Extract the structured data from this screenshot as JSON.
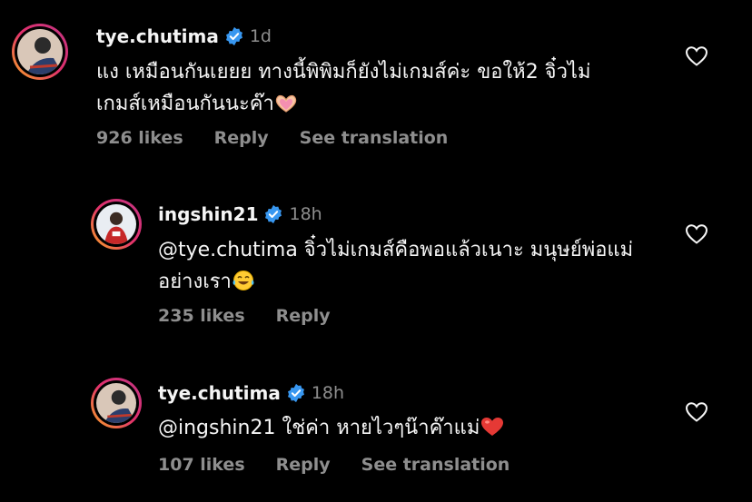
{
  "comments": [
    {
      "username": "tye.chutima",
      "time": "1d",
      "text_lines": [
        "แง เหมือนกันเยยย ทางนี้พิพิมก็ยังไม่เกมส์ค่ะ ขอให้2 จิ๋วไม่",
        "เกมส์เหมือนกันนะค๊า"
      ],
      "emoji_name": "heart-hands",
      "likes": "926 likes",
      "reply": "Reply",
      "translation": "See translation"
    },
    {
      "username": "ingshin21",
      "time": "18h",
      "text_lines": [
        "@tye.chutima จิ๋วไม่เกมส์คือพอแล้วเนาะ มนุษย์พ่อแม่",
        "อย่างเรา"
      ],
      "emoji_name": "laughing-tears",
      "likes": "235 likes",
      "reply": "Reply"
    },
    {
      "username": "tye.chutima",
      "time": "18h",
      "text_lines": [
        "@ingshin21 ใช่ค่า หายไวๆน๊าค๊าแม่"
      ],
      "emoji_name": "red-heart",
      "likes": "107 likes",
      "reply": "Reply",
      "translation": "See translation"
    }
  ],
  "colors": {
    "background": "#000000",
    "text": "#f5f5f5",
    "muted": "#8e8e8e",
    "verified": "#3897f0",
    "story_ring_start": "#f9a825",
    "story_ring_end": "#c13584"
  }
}
